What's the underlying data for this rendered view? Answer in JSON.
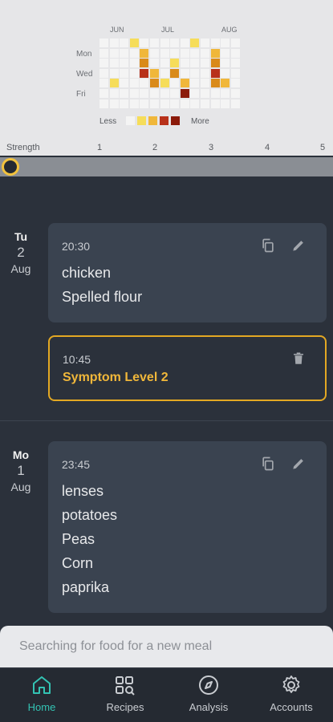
{
  "heatmap": {
    "months": [
      "JUN",
      "JUL",
      "AUG"
    ],
    "day_labels": [
      "Mon",
      "Wed",
      "Fri"
    ],
    "legend_less": "Less",
    "legend_more": "More",
    "colors": {
      "empty": "#f4f4f4",
      "level1": "#f6dd5a",
      "level2": "#f0b73a",
      "level3": "#d98a1a",
      "level4": "#b8311a",
      "level5": "#8b1a0a"
    },
    "weeks": [
      [
        0,
        0,
        0,
        0,
        0,
        0,
        0
      ],
      [
        0,
        0,
        0,
        0,
        1,
        0,
        0
      ],
      [
        0,
        0,
        0,
        0,
        0,
        0,
        0
      ],
      [
        1,
        0,
        0,
        0,
        0,
        0,
        0
      ],
      [
        0,
        2,
        3,
        4,
        0,
        0,
        0
      ],
      [
        0,
        0,
        0,
        2,
        3,
        0,
        0
      ],
      [
        0,
        0,
        0,
        0,
        1,
        0,
        0
      ],
      [
        0,
        0,
        1,
        3,
        0,
        0,
        0
      ],
      [
        0,
        0,
        0,
        0,
        2,
        5,
        0
      ],
      [
        1,
        0,
        0,
        0,
        0,
        0,
        0
      ],
      [
        0,
        0,
        0,
        0,
        0,
        0,
        0
      ],
      [
        0,
        2,
        3,
        4,
        3,
        0,
        0
      ],
      [
        0,
        0,
        0,
        0,
        2,
        0,
        0
      ],
      [
        0,
        0,
        0,
        0,
        0,
        0,
        0
      ]
    ]
  },
  "strength": {
    "label": "Strength",
    "ticks": [
      "1",
      "2",
      "3",
      "4",
      "5"
    ],
    "value": 1
  },
  "days": [
    {
      "dow": "Tu",
      "day": "2",
      "month": "Aug",
      "meal": {
        "time": "20:30",
        "items": [
          "chicken",
          "Spelled flour"
        ]
      },
      "symptom": {
        "time": "10:45",
        "label": "Symptom Level 2"
      }
    },
    {
      "dow": "Mo",
      "day": "1",
      "month": "Aug",
      "meal": {
        "time": "23:45",
        "items": [
          "lenses",
          "potatoes",
          "Peas",
          "Corn",
          "paprika"
        ]
      }
    }
  ],
  "search": {
    "placeholder": "Searching for food for a new meal"
  },
  "nav": [
    {
      "label": "Home",
      "icon": "home-icon",
      "active": true
    },
    {
      "label": "Recipes",
      "icon": "recipes-icon",
      "active": false
    },
    {
      "label": "Analysis",
      "icon": "compass-icon",
      "active": false
    },
    {
      "label": "Accounts",
      "icon": "gear-icon",
      "active": false
    }
  ],
  "accent": "#33c3b3",
  "highlight": "#e3a823"
}
